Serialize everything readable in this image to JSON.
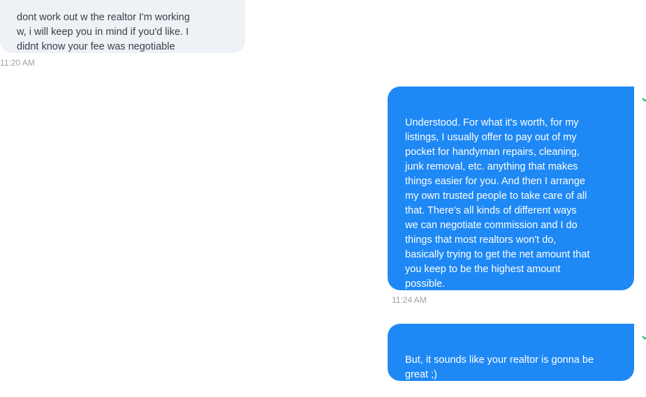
{
  "conversation": {
    "messages": [
      {
        "direction": "incoming",
        "text": "dont work out w the realtor I'm  working\nw, i will keep you in mind if you'd like. I\ndidnt know your fee was negotiable",
        "time": "11:20 AM"
      },
      {
        "direction": "outgoing",
        "text": "Understood.  For what it's worth, for my\nlistings, I usually offer to pay out of my\npocket for handyman repairs, cleaning,\njunk removal, etc. anything that makes\nthings easier for you.  And then I arrange\nmy own trusted people to take care of all\nthat.  There's all kinds of different ways\nwe can negotiate commission and I do\nthings that most realtors won't do,\nbasically trying to get the net amount that\nyou keep to be the highest amount\npossible.",
        "time": "11:24 AM",
        "status_icon": "delivered-check-icon",
        "status_color": "#2bb673"
      },
      {
        "direction": "outgoing",
        "text": "But, it sounds like your realtor is gonna be\ngreat ;)",
        "status_icon": "delivered-check-icon",
        "status_color": "#2bb673"
      }
    ]
  },
  "colors": {
    "incoming_bubble": "#eef1f6",
    "incoming_text": "#3b4048",
    "outgoing_bubble": "#1e88f5",
    "outgoing_text": "#ffffff",
    "timestamp": "#9aa1aa"
  }
}
